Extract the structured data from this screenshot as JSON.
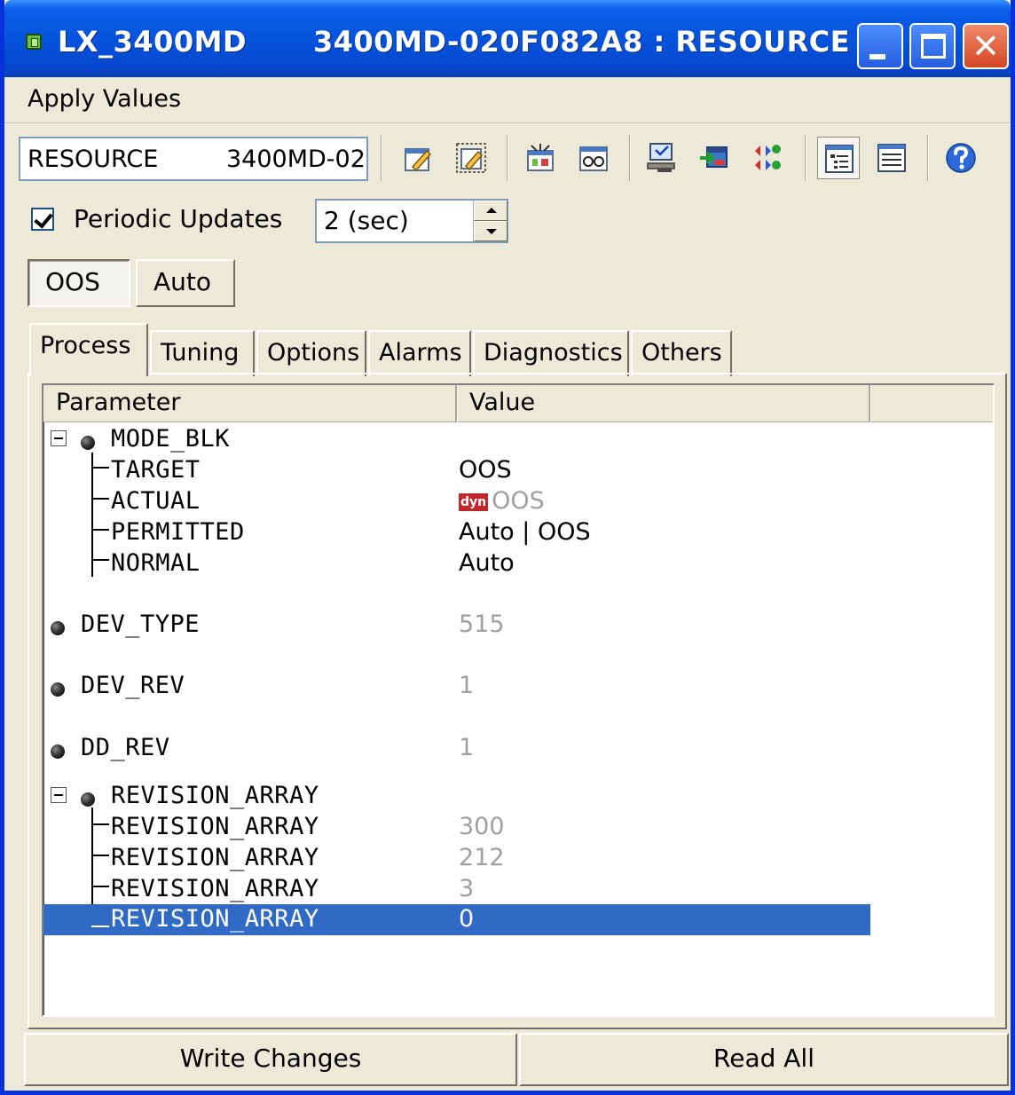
{
  "window": {
    "title_left": "LX_3400MD",
    "title_right": "3400MD-020F082A8 : RESOURCE ...",
    "close_glyph": "✕"
  },
  "menu": {
    "items": [
      "Apply Values"
    ]
  },
  "toolbar": {
    "block_name": "RESOURCE",
    "block_id": "3400MD-02("
  },
  "periodic": {
    "label": "Periodic Updates",
    "checked": true,
    "interval": "2 (sec)"
  },
  "mode_buttons": {
    "oos": "OOS",
    "auto": "Auto"
  },
  "tabs": [
    "Process",
    "Tuning",
    "Options",
    "Alarms",
    "Diagnostics",
    "Others"
  ],
  "tree": {
    "columns": {
      "parameter": "Parameter",
      "value": "Value"
    },
    "rows": [
      {
        "name": "MODE_BLK",
        "value": ""
      },
      {
        "name": "TARGET",
        "value": "OOS"
      },
      {
        "name": "ACTUAL",
        "value": "OOS",
        "badge": "dyn"
      },
      {
        "name": "PERMITTED",
        "value": "Auto | OOS"
      },
      {
        "name": "NORMAL",
        "value": "Auto"
      },
      {
        "name": "DEV_TYPE",
        "value": "515"
      },
      {
        "name": "DEV_REV",
        "value": "1"
      },
      {
        "name": "DD_REV",
        "value": "1"
      },
      {
        "name": "REVISION_ARRAY",
        "value": ""
      },
      {
        "name": "REVISION_ARRAY",
        "value": "300"
      },
      {
        "name": "REVISION_ARRAY",
        "value": "212"
      },
      {
        "name": "REVISION_ARRAY",
        "value": "3"
      },
      {
        "name": "REVISION_ARRAY",
        "value": "0"
      }
    ]
  },
  "buttons": {
    "write": "Write Changes",
    "read": "Read All"
  },
  "colors": {
    "title_bar": "#0653dd",
    "selection": "#316ac5",
    "dyn_badge": "#c0282e",
    "dim_text": "#a0a0a0"
  }
}
